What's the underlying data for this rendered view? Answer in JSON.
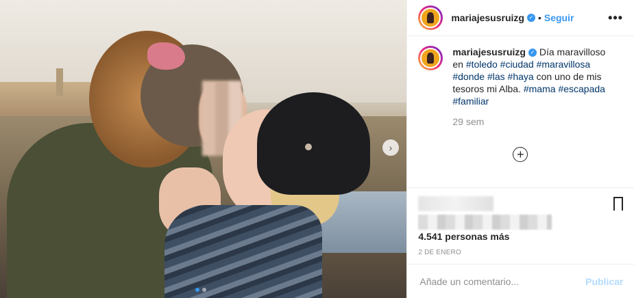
{
  "header": {
    "username": "mariajesusruizg",
    "separator": "•",
    "follow_label": "Seguir",
    "more_label": "•••"
  },
  "caption": {
    "username": "mariajesusruizg",
    "text_start": "Día maravilloso en",
    "tags_line1": [
      "#toledo",
      "#ciudad",
      "#maravillosa"
    ],
    "tags_line2": [
      "#donde",
      "#las",
      "#haya"
    ],
    "text_mid": "con uno de mis tesoros mi Alba.",
    "tags_line3": [
      "#mama",
      "#escapada"
    ],
    "tags_line4": [
      "#familiar"
    ],
    "time": "29 sem"
  },
  "actions": {
    "likes_text": "4.541 personas más",
    "date": "2 DE ENERO"
  },
  "comment": {
    "placeholder": "Añade un comentario...",
    "publish_label": "Publicar"
  },
  "carousel": {
    "total": 2,
    "current": 1
  },
  "colors": {
    "accent": "#3897f0",
    "hashtag": "#003569",
    "muted": "#8e8e8e",
    "publish_disabled": "#b3dbff"
  }
}
